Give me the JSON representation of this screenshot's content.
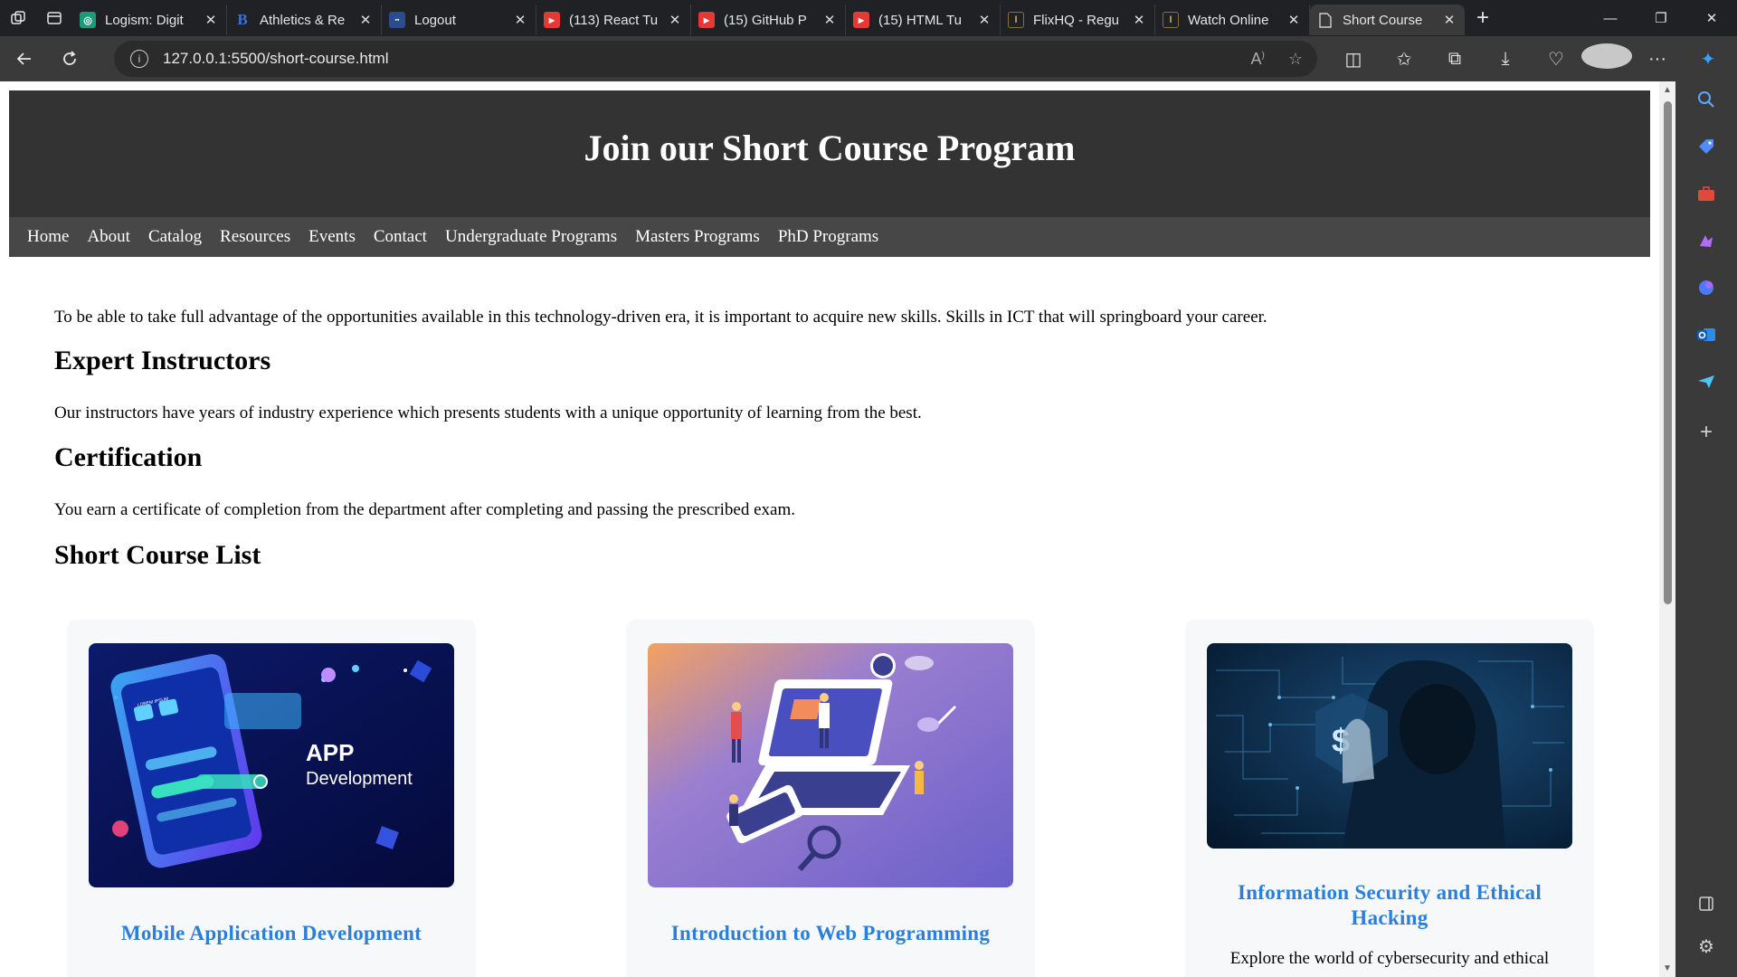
{
  "browser": {
    "tabs": [
      {
        "label": "Logism: Digit",
        "favicon": "chatgpt-icon",
        "color": "#1a9c7a"
      },
      {
        "label": "Athletics & Re",
        "favicon": "b-letter-icon",
        "color": "#3d6fd9"
      },
      {
        "label": "Logout",
        "favicon": "site-logo-icon",
        "color": "#2a4d8f"
      },
      {
        "label": "(113) React Tu",
        "favicon": "youtube-icon",
        "color": "#e53935"
      },
      {
        "label": "(15) GitHub P",
        "favicon": "youtube-icon",
        "color": "#e53935"
      },
      {
        "label": "(15) HTML Tu",
        "favicon": "youtube-icon",
        "color": "#e53935"
      },
      {
        "label": "FlixHQ - Regu",
        "favicon": "flixhq-icon",
        "color": "#8a6d3b"
      },
      {
        "label": "Watch Online",
        "favicon": "flixhq-icon",
        "color": "#8a6d3b"
      },
      {
        "label": "Short Course",
        "favicon": "document-icon",
        "color": "#d0d0d0"
      }
    ],
    "url": "127.0.0.1:5500/short-course.html"
  },
  "page": {
    "title": "Join our Short Course Program",
    "nav": [
      "Home",
      "About",
      "Catalog",
      "Resources",
      "Events",
      "Contact",
      "Undergraduate Programs",
      "Masters Programs",
      "PhD Programs"
    ],
    "intro": "To be able to take full advantage of the opportunities available in this technology-driven era, it is important to acquire new skills. Skills in ICT that will springboard your career.",
    "sections": [
      {
        "heading": "Expert Instructors",
        "text": "Our instructors have years of industry experience which presents students with a unique opportunity of learning from the best."
      },
      {
        "heading": "Certification",
        "text": "You earn a certificate of completion from the department after completing and passing the prescribed exam."
      }
    ],
    "list_heading": "Short Course List",
    "courses": [
      {
        "title": "Mobile Application Development",
        "image_text_1": "APP",
        "image_text_2": "Development",
        "image_text_3": "LOREM IPSUM"
      },
      {
        "title": "Introduction to Web Programming"
      },
      {
        "title": "Information Security and Ethical Hacking",
        "description": "Explore the world of cybersecurity and ethical"
      }
    ]
  },
  "colors": {
    "header_bg": "#333333",
    "nav_bg": "#474747",
    "course_title": "#2a7fdc",
    "card_bg": "#f7f8fa"
  }
}
